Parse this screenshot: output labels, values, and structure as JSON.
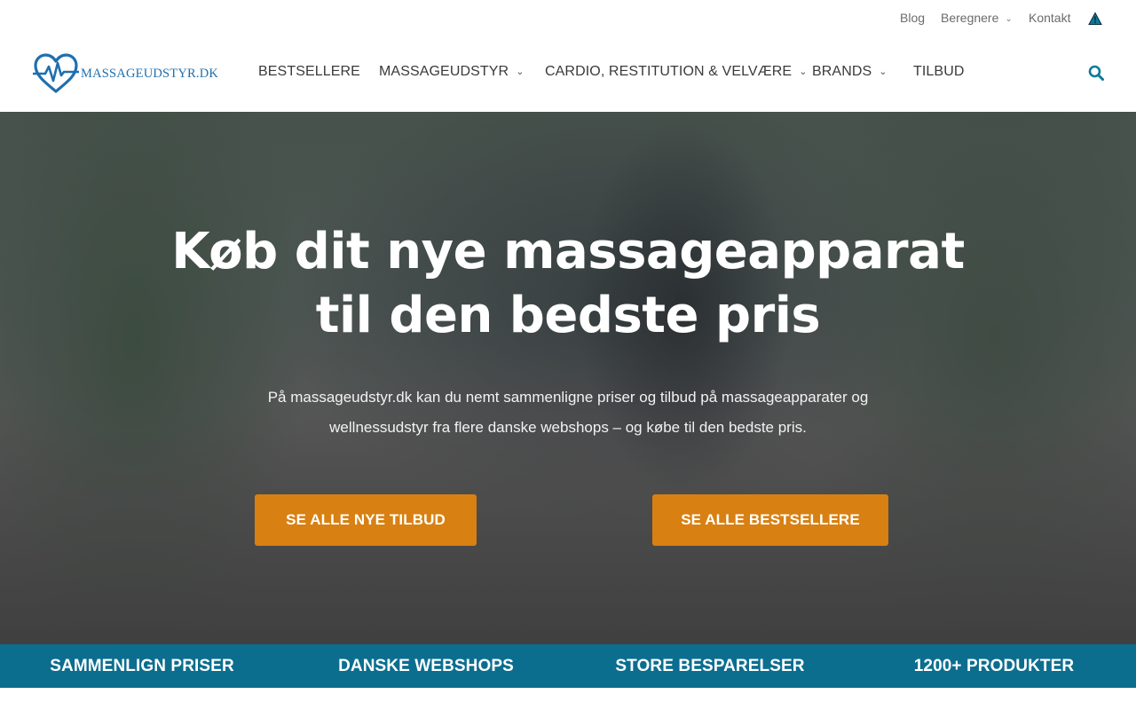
{
  "topbar": {
    "blog": "Blog",
    "calculators": "Beregnere",
    "contact": "Kontakt",
    "warning_icon": "warning-triangle-icon"
  },
  "header": {
    "logo_text": "MASSAGEUDSTYR.DK",
    "logo_icon": "heart-pulse-icon",
    "nav": [
      {
        "label": "BESTSELLERE",
        "has_dropdown": false
      },
      {
        "label": "MASSAGEUDSTYR",
        "has_dropdown": true
      },
      {
        "label": "CARDIO, RESTITUTION & VELVÆRE",
        "has_dropdown": true
      },
      {
        "label": "BRANDS",
        "has_dropdown": true
      },
      {
        "label": "TILBUD",
        "has_dropdown": false
      }
    ],
    "search_icon": "search-icon",
    "accent_color": "#0b7a9a"
  },
  "hero": {
    "title_line1": "Køb dit nye massageapparat",
    "title_line2": "til den bedste pris",
    "description": "På massageudstyr.dk kan du nemt sammenligne priser og tilbud på massageapparater og wellnessudstyr fra flere danske webshops – og købe til den bedste pris.",
    "button_offers": "SE ALLE NYE TILBUD",
    "button_bestsellers": "SE ALLE BESTSELLERE",
    "button_color": "#d88012"
  },
  "features": {
    "bar_color": "#0b6e8f",
    "items": [
      "SAMMENLIGN PRISER",
      "DANSKE WEBSHOPS",
      "STORE BESPARELSER",
      "1200+ PRODUKTER"
    ]
  }
}
